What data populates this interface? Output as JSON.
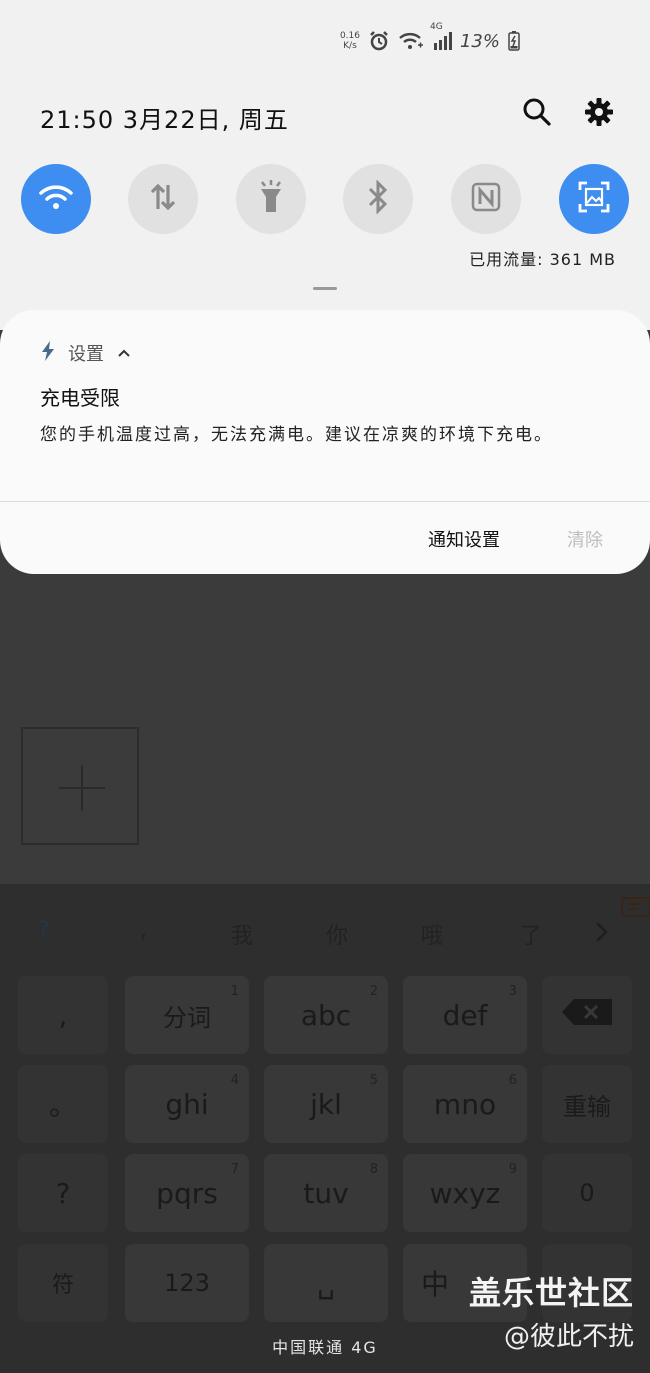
{
  "status_bar": {
    "net_speed_value": "0.16",
    "net_speed_unit": "K/s",
    "network_type": "4G",
    "battery": "13%",
    "icons": [
      "alarm-icon",
      "wifi-calling-icon",
      "signal-icon",
      "battery-charging-icon"
    ]
  },
  "header": {
    "datetime": "21:50  3月22日, 周五",
    "icons": [
      "search-icon",
      "gear-icon"
    ]
  },
  "quick_settings": [
    {
      "name": "wifi-icon",
      "active": true
    },
    {
      "name": "mobile-data-icon",
      "active": false
    },
    {
      "name": "flashlight-icon",
      "active": false
    },
    {
      "name": "bluetooth-icon",
      "active": false
    },
    {
      "name": "nfc-icon",
      "active": false
    },
    {
      "name": "screenshot-icon",
      "active": true
    }
  ],
  "data_usage": "已用流量: 361 MB",
  "notification": {
    "app_label": "设置",
    "title": "充电受限",
    "body": "您的手机温度过高，无法充满电。建议在凉爽的环境下充电。",
    "actions": {
      "settings": "通知设置",
      "clear": "清除"
    }
  },
  "keyboard": {
    "candidates": [
      "?",
      ",",
      "我",
      "你",
      "哦",
      "了"
    ],
    "left_column": [
      ",",
      "。",
      "?",
      "符"
    ],
    "rows": [
      [
        {
          "label": "分词",
          "num": "1"
        },
        {
          "label": "abc",
          "num": "2"
        },
        {
          "label": "def",
          "num": "3"
        }
      ],
      [
        {
          "label": "ghi",
          "num": "4"
        },
        {
          "label": "jkl",
          "num": "5"
        },
        {
          "label": "mno",
          "num": "6"
        }
      ],
      [
        {
          "label": "pqrs",
          "num": "7"
        },
        {
          "label": "tuv",
          "num": "8"
        },
        {
          "label": "wxyz",
          "num": "9"
        }
      ],
      [
        {
          "label": "123",
          "num": ""
        },
        {
          "label": "␣",
          "num": ""
        },
        {
          "label": "中",
          "num": ""
        }
      ]
    ],
    "right_column": [
      "⌫",
      "重输",
      "0",
      ""
    ]
  },
  "carrier": "中国联通 4G",
  "watermark": {
    "title": "盖乐世社区",
    "author": "@彼此不扰"
  },
  "colors": {
    "accent": "#3d8ef0",
    "panel": "#f1f1f1",
    "keyboard": "#2e2e2e"
  }
}
